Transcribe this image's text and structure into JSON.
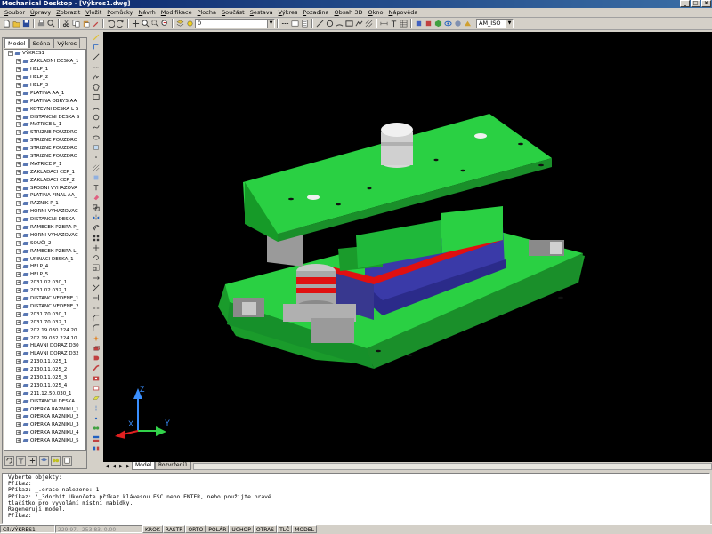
{
  "window": {
    "title": "Mechanical Desktop - [Výkres1.dwg]",
    "buttons": [
      "_",
      "□",
      "×"
    ]
  },
  "menu": [
    "Soubor",
    "Úpravy",
    "Zobrazit",
    "Vložit",
    "Pomůcky",
    "Návrh",
    "Modifikace",
    "Plocha",
    "Součást",
    "Sestava",
    "Výkres",
    "Pozadina",
    "Obsah 3D",
    "Okno",
    "Nápověda"
  ],
  "toolbar": {
    "layer_value": "0",
    "view_value": "AM_ISO"
  },
  "browser": {
    "tabs": [
      "Model",
      "Scéna",
      "Výkres"
    ],
    "active_tab": "Model",
    "root": "VÝKRES1",
    "items": [
      "ZAKLADNI DESKA_1",
      "HELP_1",
      "HELP_2",
      "HELP_3",
      "PLATINA AA_1",
      "PLATINA OBRYS AA",
      "KOTEVNI DESKA L S",
      "DISTANCNI DESKA S",
      "MATRICE L_1",
      "STRIZNE POUZDRO",
      "STRIZNE POUZDRO",
      "STRIZNE POUZDRO",
      "STRIZNE POUZDRO",
      "MATRICE P_1",
      "ZAKLADACI CEP_1",
      "ZAKLADACI CEP_2",
      "SPODNI VYHAZOVA",
      "PLATINA FINAL AA_",
      "RAZNIK P_1",
      "HORNI VYHAZOVAC",
      "DISTANCNI DESKA I",
      "RAMECEK PZBRA P_",
      "HORNI VYHAZOVAC",
      "SOUČI_2",
      "RAMECEK PZBRA L_",
      "UPINACI DESKA_1",
      "HELP_4",
      "HELP_5",
      "2031.02.030_1",
      "2031.02.032_1",
      "DISTANC VEDENE_1",
      "DISTANC VEDENE_2",
      "2031.70.030_1",
      "2031.70.032_1",
      "202.19.030.224.20",
      "202.19.032.224.10",
      "HLAVNI DORAZ D30",
      "HLAVNI DORAZ D32",
      "2130.11.025_1",
      "2130.11.025_2",
      "2130.11.025_3",
      "2130.11.025_4",
      "211.12.50.030_1",
      "DISTANCNI DESKA I",
      "OPERKA RAZNIKU_1",
      "OPERKA RAZNIKU_2",
      "OPERKA RAZNIKU_3",
      "OPERKA RAZNIKU_4",
      "OPERKA RAZNIKU_5"
    ]
  },
  "layout_tabs": [
    "Model",
    "Rozvržení1"
  ],
  "ucs_labels": {
    "x": "X",
    "y": "Y",
    "z": "Z"
  },
  "command": {
    "lines": [
      "Vyberte objekty:",
      "Příkaz:",
      "Příkaz: _.erase nalezeno: 1",
      "Příkaz: '_3dorbit Ukončete příkaz klávesou ESC nebo ENTER, nebo použijte pravé",
      "tlačítko pro vyvolání místní nabídky.",
      "Regeneruji model.",
      "",
      "Příkaz:"
    ]
  },
  "status": {
    "context": "Cíl:VÝKRES1",
    "coords": "229.97, -253.83, 0.00",
    "toggles": [
      "KROK",
      "RASTR",
      "ORTO",
      "POLÁR",
      "UCHOP",
      "OTRAS",
      "TLČ",
      "MODEL"
    ]
  },
  "colors": {
    "plate": "#22c93a",
    "plate_dark": "#169a28",
    "viewport_bg": "#000000",
    "block": "#3c3c9c",
    "red": "#e01010",
    "steel": "#a8a8a8"
  }
}
